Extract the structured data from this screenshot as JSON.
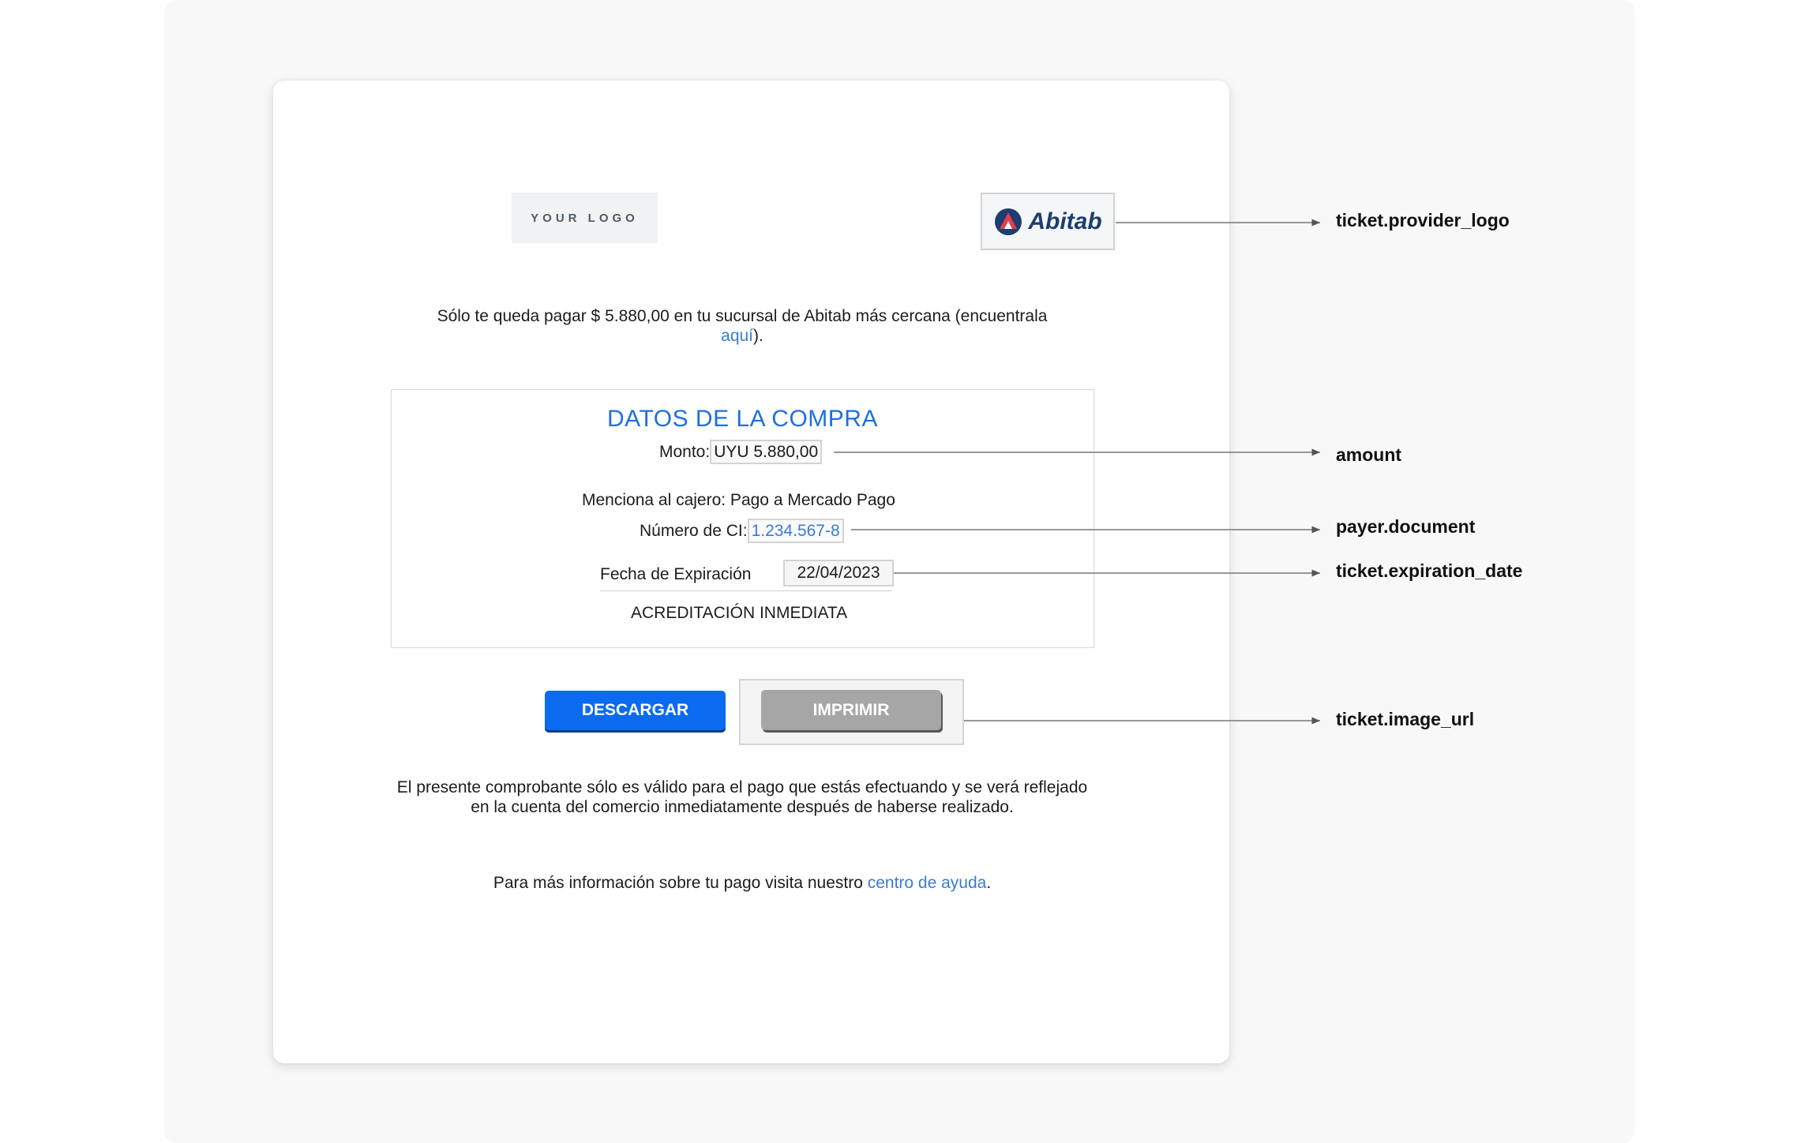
{
  "ticket": {
    "your_logo_text": "YOUR LOGO",
    "provider_logo_text": "Abitab",
    "intro_text": "Sólo te queda pagar $ 5.880,00 en tu sucursal de Abitab más cercana (encuentrala",
    "intro_link": "aquí",
    "intro_end": ").",
    "box_title": "DATOS DE LA COMPRA",
    "amount_label": "Monto:",
    "amount_value": "UYU 5.880,00",
    "cashier_text": "Menciona al cajero: Pago a Mercado Pago",
    "document_label": "Número de CI:",
    "document_value": "1.234.567-8",
    "expiration_label": "Fecha de Expiración",
    "expiration_value": "22/04/2023",
    "accreditation": "ACREDITACIÓN INMEDIATA",
    "download_label": "DESCARGAR",
    "print_label": "IMPRIMIR",
    "notice_text": "El presente comprobante sólo es válido para el pago que estás efectuando y se verá reflejado en la cuenta del comercio inmediatamente después de haberse realizado.",
    "help_prefix": "Para más información sobre tu pago visita nuestro",
    "help_link": "centro de ayuda",
    "help_suffix": "."
  },
  "annotations": {
    "provider_logo": "ticket.provider_logo",
    "amount": "amount",
    "payer_document": "payer.document",
    "expiration_date": "ticket.expiration_date",
    "image_url": "ticket.image_url"
  },
  "colors": {
    "accent_blue": "#0a6bf0",
    "title_blue": "#1f6fe0",
    "link_blue": "#3a7bd5",
    "provider_navy": "#1d3d6e",
    "provider_red": "#e23b4e",
    "print_gray": "#a6a6a6"
  }
}
